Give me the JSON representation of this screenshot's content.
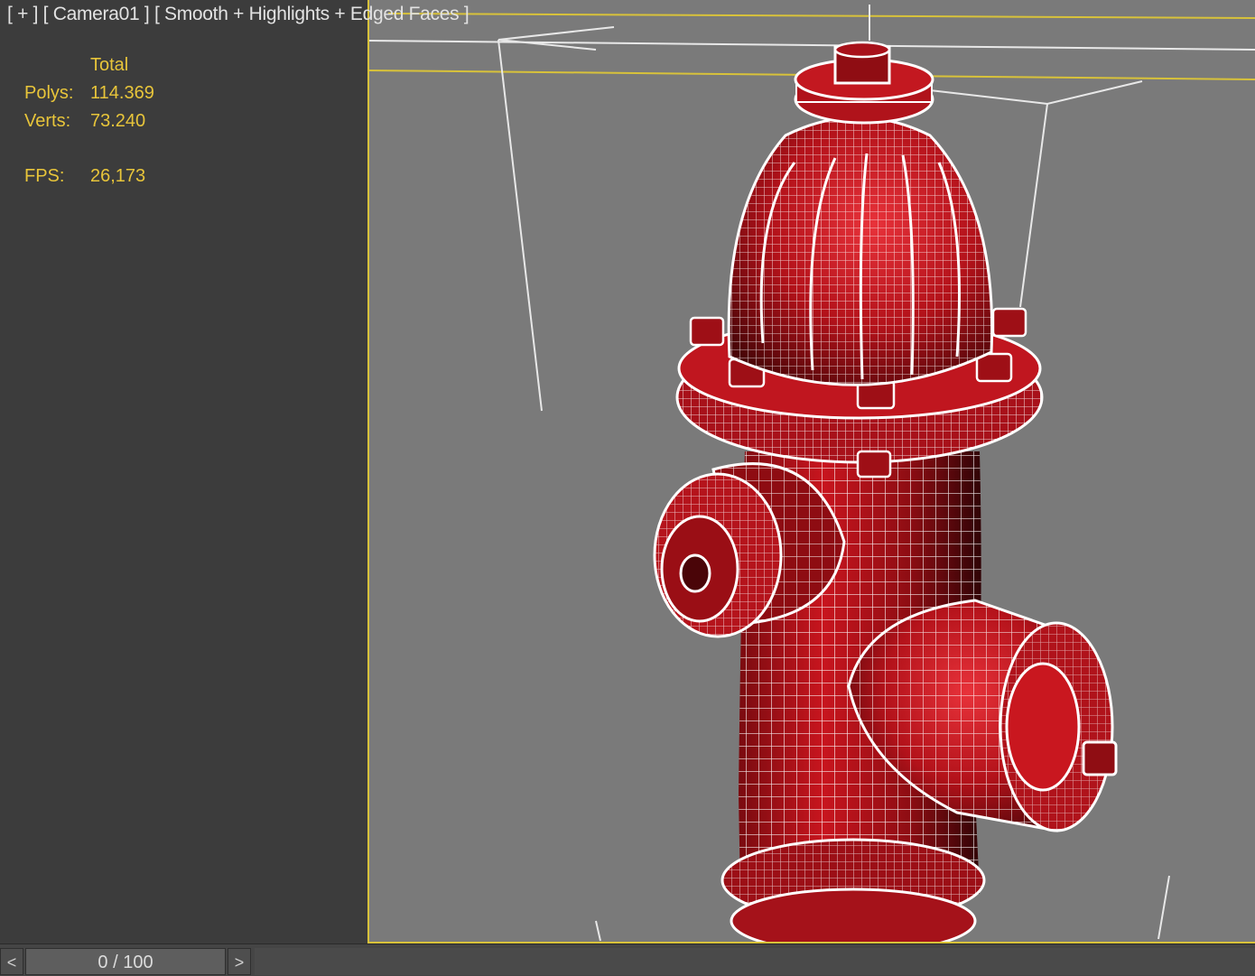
{
  "viewport": {
    "label": "[ + ] [ Camera01 ] [ Smooth + Highlights + Edged Faces ]"
  },
  "stats": {
    "header": "Total",
    "polys_label": "Polys:",
    "polys_value": "114.369",
    "verts_label": "Verts:",
    "verts_value": "73.240",
    "fps_label": "FPS:",
    "fps_value": "26,173"
  },
  "timeline": {
    "prev_label": "<",
    "slider_text": "0 / 100",
    "next_label": ">"
  },
  "colors": {
    "stats_text": "#e8c53a",
    "viewport_bg": "#7a7a7a",
    "active_border": "#d8c23a",
    "model_red": "#b3121a",
    "wire": "#ffffff"
  },
  "icons": {
    "prev": "chevron-left-icon",
    "next": "chevron-right-icon"
  }
}
